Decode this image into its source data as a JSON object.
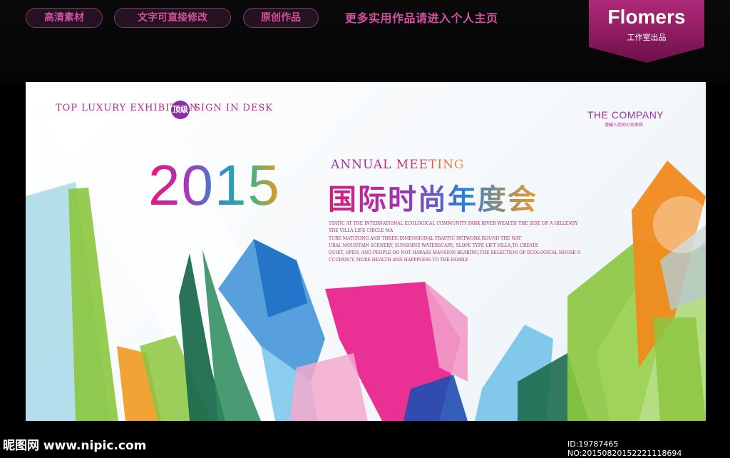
{
  "header": {
    "pills": [
      "高清素材",
      "文字可直接修改",
      "原创作品"
    ],
    "tagline": "更多实用作品请进入个人主页",
    "brand_name": "Flomers",
    "brand_sub": "工作室出品"
  },
  "banner": {
    "top_left_1": "TOP LUXURY EXHIBITION",
    "badge": "顶级",
    "top_left_2": "SIGN IN DESK",
    "company": "THE COMPANY",
    "company_sub": "请输入您的公司名称",
    "year": "2015",
    "annual": "ANNUAL MEETING",
    "cn_title": "国际时尚年度会",
    "body_lines": [
      "STATIC AT THE INTERNATIONAL ECOLOGICAL COMMUNITY PARK RIVER WEALTH THE SIDE OF A HILLENSY",
      "THE VILLA LIFE CIRCLE MA",
      "TURE MATCHING AND THREE-DIMENSIONAL TRAFFIC NETWORK,ROUND THE NAT",
      "URAL MOUNTAIN SCENERY, SUNSHINE WATERSCAPE, SLOPE TYPE LIFT VILLA,TO CREATE",
      "QUIET, OPEN, AND PEOPLE DO NOT HARASS MANSION BEARING,THE SELECTION OF ECOLOGICAL HOUSE O",
      "CCUPANCY, MORE HEALTH AND HAPPINESS TO THE FAMILY."
    ]
  },
  "footer": {
    "site": "昵图网 www.nipic.com",
    "id": "ID:19787465 NO:20150820152221118694"
  },
  "colors": {
    "pink": "#d61e7c",
    "purple": "#8e2ea6",
    "blue": "#2e7fd0",
    "green": "#8cc63f",
    "orange": "#f09a20"
  }
}
